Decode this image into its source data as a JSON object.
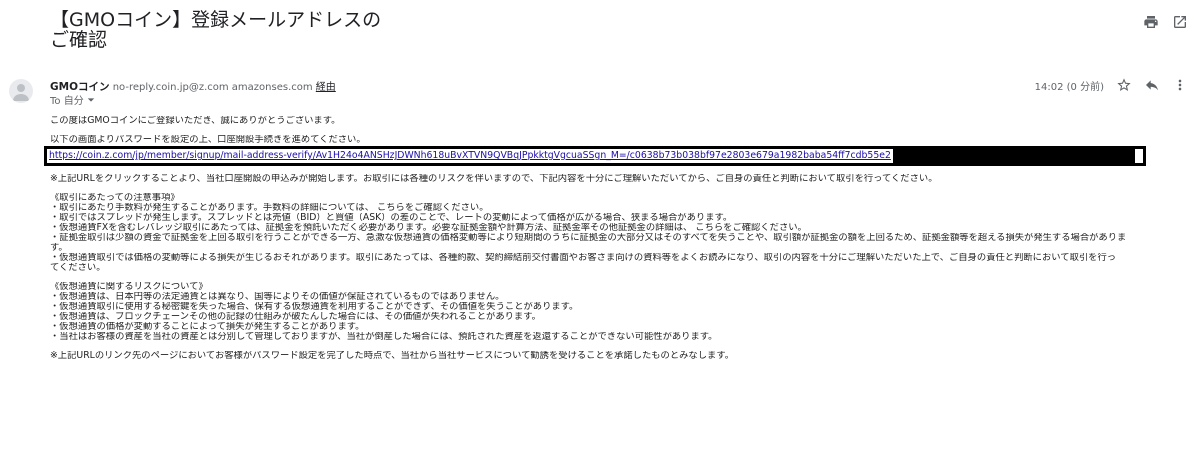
{
  "email": {
    "subject": "【GMOコイン】登録メールアドレスのご確認",
    "sender_name": "GMOコイン",
    "sender_email": "no-reply.coin.jp@z.com",
    "via_domain": "amazonses.com",
    "via_label": "経由",
    "to_label": "To 自分",
    "time": "14:02 (0 分前)"
  },
  "icons": {
    "print": "print-icon",
    "open_new": "open-in-new-icon",
    "star": "star-icon",
    "reply": "reply-icon",
    "more": "more-vert-icon",
    "avatar": "avatar-icon",
    "dropdown": "chevron-down-icon"
  },
  "body": {
    "greeting": "この度はGMOコインにご登録いただき、誠にありがとうございます。",
    "instruction": "以下の画面よりパスワードを設定の上、口座開設手続きを進めてください。",
    "url": "https://coin.z.com/jp/member/signup/mail-address-verify/Av1H24o4ANSHzJDWNh618uBvXTVN9QVBqJPpkktgVgcuaSSgn_M=/c0638b73b038bf97e2803e679a1982baba54ff7cdb55e2",
    "notice": "※上記URLをクリックすることより、当社口座開設の申込みが開始します。お取引には各種のリスクを伴いますので、下記内容を十分にご理解いただいてから、ご自身の責任と判断において取引を行ってください。",
    "section1_title": "《取引にあたっての注意事項》",
    "section1_items": [
      "・取引にあたり手数料が発生することがあります。手数料の詳細については、 こちらをご確認ください。",
      "・取引ではスプレッドが発生します。スプレッドとは売値（BID）と買値（ASK）の差のことで、レートの変動によって価格が広がる場合、狭まる場合があります。",
      "・仮想通貨FXを含むレバレッジ取引にあたっては、証拠金を預託いただく必要があります。必要な証拠金額や計算方法、証拠金率その他証拠金の詳細は、 こちらをご確認ください。",
      "・証拠金取引は少額の資金で証拠金を上回る取引を行うことができる一方、急激な仮想通貨の価格変動等により短期間のうちに証拠金の大部分又はそのすべてを失うことや、取引額が証拠金の額を上回るため、証拠金額等を超える損失が発生する場合がありま",
      "す。",
      "・仮想通貨取引では価格の変動等による損失が生じるおそれがあります。取引にあたっては、各種約款、契約締結前交付書面やお客さま向けの資料等をよくお読みになり、取引の内容を十分にご理解いただいた上で、ご自身の責任と判断において取引を行っ",
      "てください。"
    ],
    "section2_title": "《仮想通貨に関するリスクについて》",
    "section2_items": [
      "・仮想通貨は、日本円等の法定通貨とは異なり、国等によりその価値が保証されているものではありません。",
      "・仮想通貨取引に使用する秘密鍵を失った場合、保有する仮想通貨を利用することができず、その価値を失うことがあります。",
      "・仮想通貨は、ブロックチェーンその他の記録の仕組みが破たんした場合には、その価値が失われることがあります。",
      "・仮想通貨の価格が変動することによって損失が発生することがあります。",
      "・当社はお客様の資産を当社の資産とは分別して管理しておりますが、当社が倒産した場合には、預託された資産を返還することができない可能性があります。"
    ],
    "footer_note": "※上記URLのリンク先のページにおいてお客様がパスワード設定を完了した時点で、当社から当社サービスについて勧誘を受けることを承諾したものとみなします。"
  }
}
